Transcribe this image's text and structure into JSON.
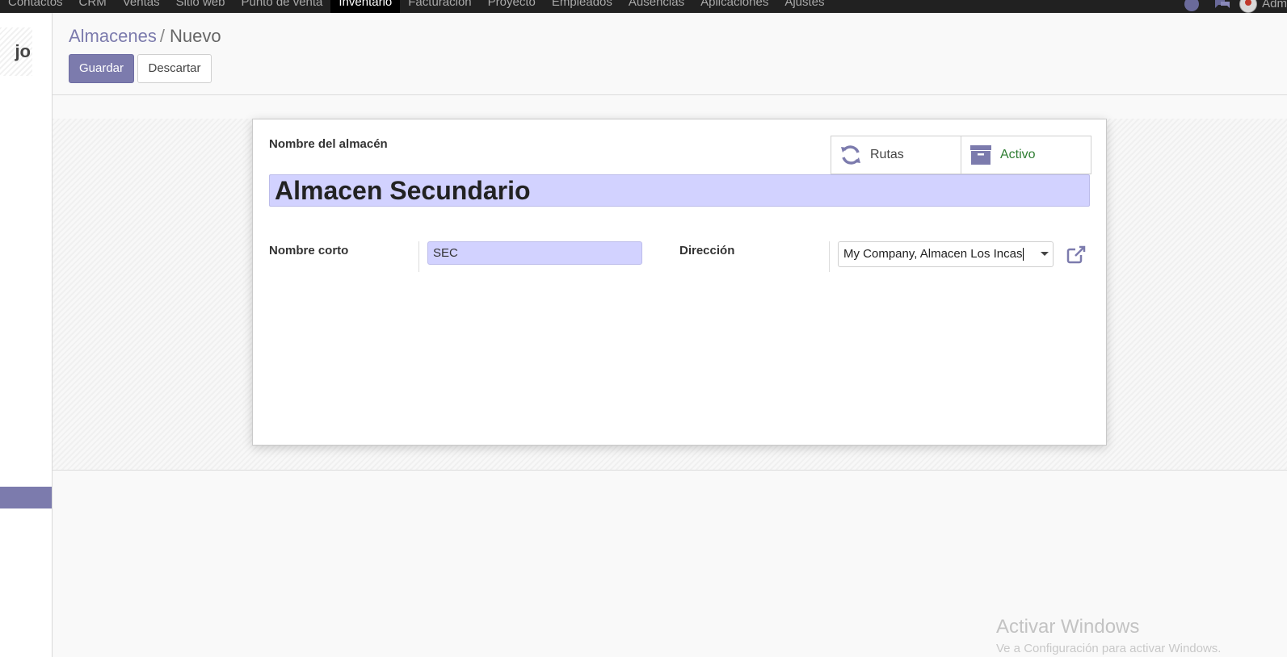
{
  "navbar": {
    "menu": [
      "Contactos",
      "CRM",
      "Ventas",
      "Sitio web",
      "Punto de venta",
      "Inventario",
      "Facturación",
      "Proyecto",
      "Empleados",
      "Ausencias",
      "Aplicaciones",
      "Ajustes"
    ],
    "active_menu": "Inventario",
    "user": "Adm"
  },
  "sidebar": {
    "logo_text": "jo"
  },
  "breadcrumb": {
    "parent": "Almacenes",
    "separator": "/",
    "current": "Nuevo"
  },
  "toolbar": {
    "save_label": "Guardar",
    "discard_label": "Descartar"
  },
  "form": {
    "name_label": "Nombre del almacén",
    "name_value": "Almacen Secundario",
    "short_name_label": "Nombre corto",
    "short_name_value": "SEC",
    "address_label": "Dirección",
    "address_value": "My Company, Almacen Los Incas"
  },
  "smart_buttons": {
    "routes_label": "Rutas",
    "active_label": "Activo"
  },
  "watermark": {
    "line1": "Activar Windows",
    "line2": "Ve a Configuración para activar Windows."
  },
  "colors": {
    "primary": "#7c7bad",
    "navbar": "#212121",
    "required_field": "#d2d2ff",
    "active_text": "#2e7d32"
  }
}
